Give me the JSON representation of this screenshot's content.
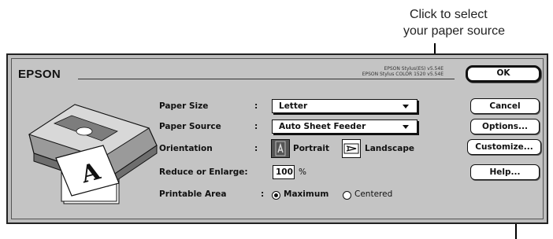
{
  "callouts": {
    "paper_source_line1": "Click to select",
    "paper_source_line2": "your paper source"
  },
  "dialog": {
    "brand": "EPSON",
    "version_line1": "EPSON Stylus(ES) v5.54E",
    "version_line2": "EPSON Stylus COLOR 1520 v5.54E"
  },
  "form": {
    "paper_size": {
      "label": "Paper Size",
      "colon": ":",
      "value": "Letter"
    },
    "paper_source": {
      "label": "Paper Source",
      "colon": ":",
      "value": "Auto Sheet Feeder"
    },
    "orientation": {
      "label": "Orientation",
      "colon": ":",
      "portrait_label": "Portrait",
      "landscape_label": "Landscape",
      "selected": "Portrait"
    },
    "reduce_enlarge": {
      "label": "Reduce or Enlarge:",
      "value": "100",
      "unit": "%"
    },
    "printable_area": {
      "label": "Printable Area",
      "colon": ":",
      "maximum_label": "Maximum",
      "centered_label": "Centered",
      "selected": "Maximum"
    }
  },
  "buttons": {
    "ok": "OK",
    "cancel": "Cancel",
    "options": "Options...",
    "customize": "Customize...",
    "help": "Help..."
  },
  "icons": {
    "printer": "printer-illustration-icon",
    "portrait": "portrait-orientation-icon",
    "landscape": "landscape-orientation-icon"
  }
}
